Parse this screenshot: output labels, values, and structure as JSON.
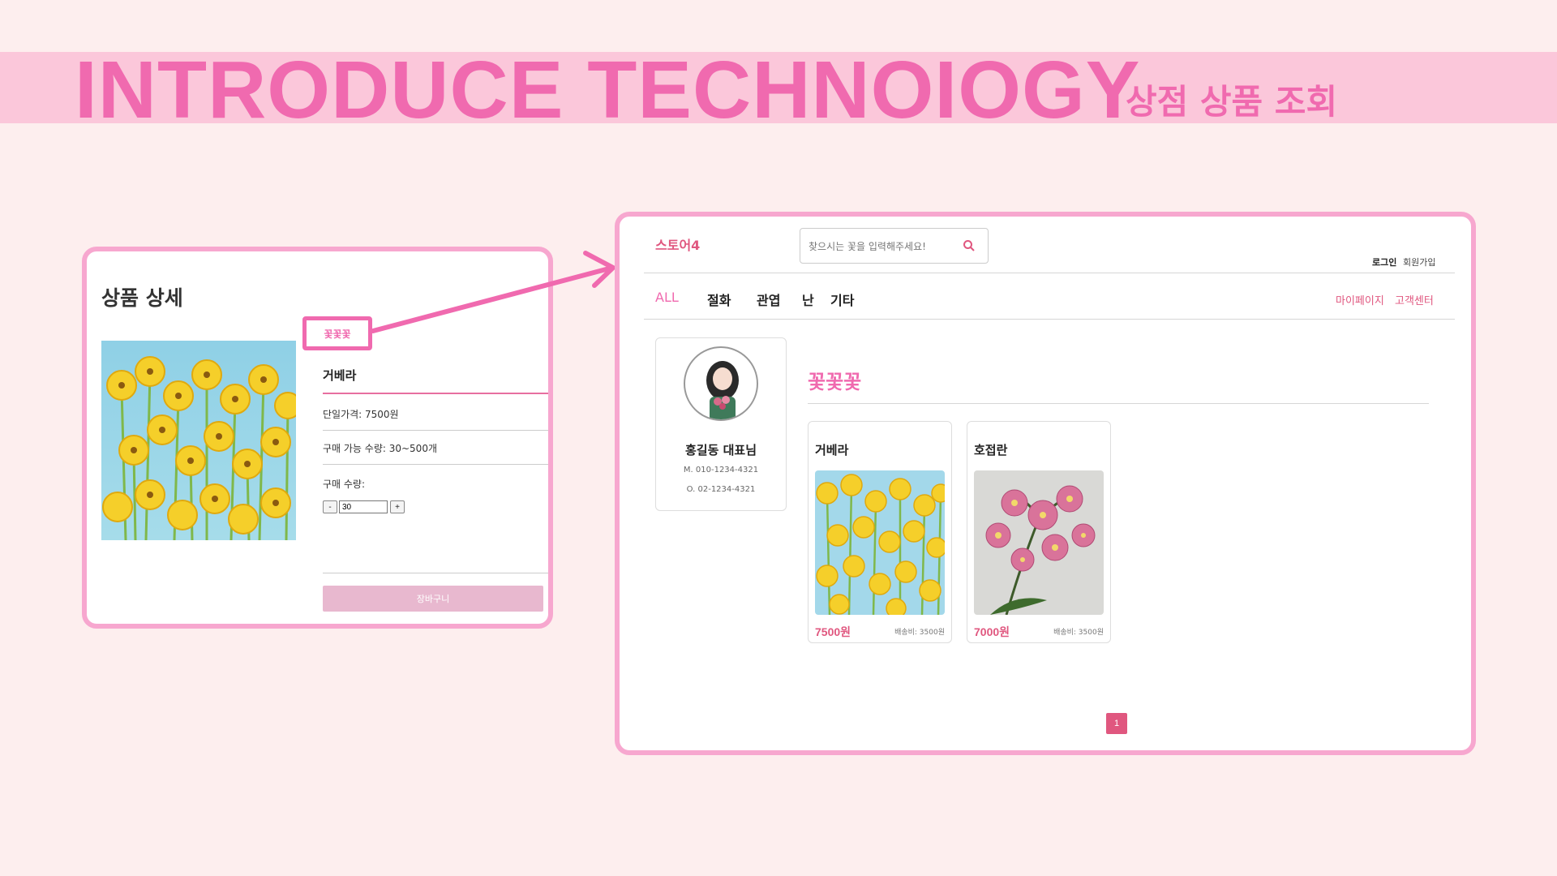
{
  "slide": {
    "title": "INTRODUCE TECHNOIOGY",
    "subtitle": "상점 상품 조회"
  },
  "detail_panel": {
    "title": "상품 상세",
    "shop_tag": "꽃꽃꽃",
    "product_name": "거베라",
    "unit_price": "단일가격: 7500원",
    "purchasable_qty": "구매 가능 수량: 30~500개",
    "qty_label": "구매 수량:",
    "qty_minus": "-",
    "qty_value": "30",
    "qty_plus": "+",
    "cart_button": "장바구니"
  },
  "shop_page": {
    "logo": "스토어4",
    "search": {
      "placeholder": "찾으시는 꽃을 입력해주세요!"
    },
    "top_links": {
      "login": "로그인",
      "signup": "회원가입"
    },
    "nav": [
      "ALL",
      "절화",
      "관엽",
      "난",
      "기타"
    ],
    "nav_right": {
      "mypage": "마이페이지",
      "support": "고객센터"
    },
    "owner": {
      "name": "홍길동 대표님",
      "mobile": "M. 010-1234-4321",
      "office": "O. 02-1234-4321"
    },
    "shop_name": "꽃꽃꽃",
    "products": [
      {
        "name": "거베라",
        "price": "7500원",
        "shipping": "배송비: 3500원"
      },
      {
        "name": "호접란",
        "price": "7000원",
        "shipping": "배송비: 3500원"
      }
    ],
    "pagination": {
      "current": "1"
    }
  },
  "colors": {
    "accent": "#f06aaf",
    "brand": "#e0577f",
    "frame": "#f7a7cf",
    "band": "#fbc7da"
  }
}
